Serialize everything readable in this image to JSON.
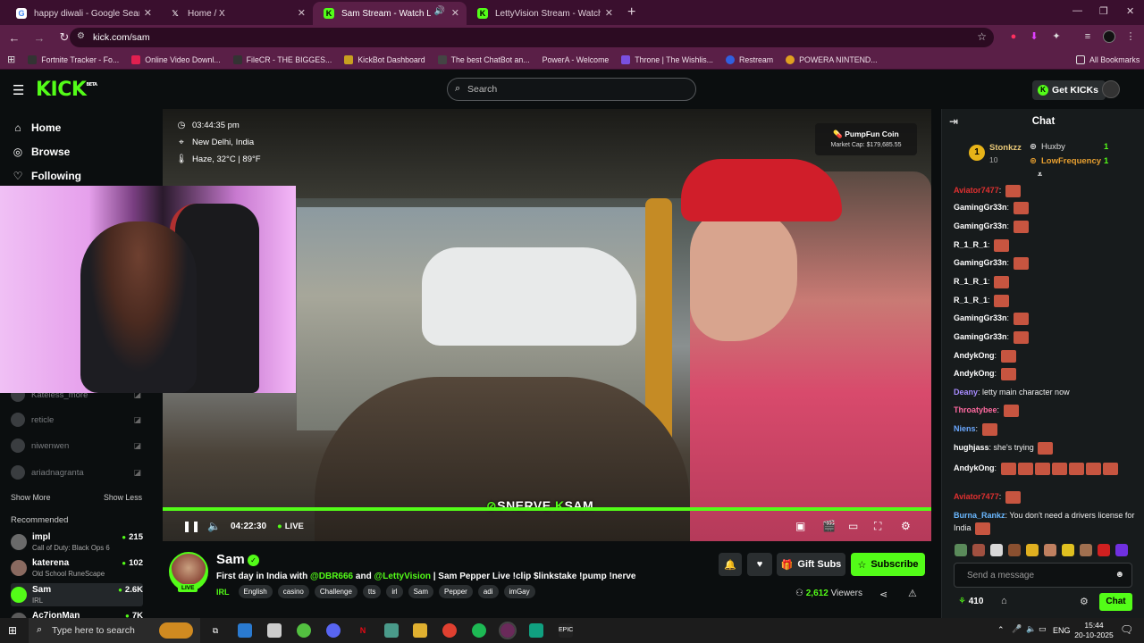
{
  "browser": {
    "tabs": [
      {
        "label": "happy diwali - Google Search",
        "icon": "google-icon",
        "active": false
      },
      {
        "label": "Home / X",
        "icon": "x-icon",
        "active": false
      },
      {
        "label": "Sam Stream - Watch Live o",
        "icon": "kick-icon",
        "active": true
      },
      {
        "label": "LettyVision Stream - Watch Liv",
        "icon": "kick-icon",
        "active": false
      }
    ],
    "new_tab": "+",
    "url": "kick.com/sam",
    "bookmarks": [
      "Fortnite Tracker - Fo...",
      "Online Video Downl...",
      "FileCR - THE BIGGES...",
      "KickBot Dashboard",
      "The best ChatBot an...",
      "PowerA - Welcome",
      "Throne | The Wishlis...",
      "Restream",
      "POWERA NINTEND..."
    ],
    "all_bookmarks": "All Bookmarks"
  },
  "header": {
    "logo": "KICK",
    "logo_badge": "BETA",
    "search_placeholder": "Search",
    "get_kicks": "Get KICKs"
  },
  "sidebar": {
    "nav": [
      {
        "label": "Home",
        "icon": "home-icon"
      },
      {
        "label": "Browse",
        "icon": "compass-icon"
      },
      {
        "label": "Following",
        "icon": "heart-icon"
      }
    ],
    "offline_following": [
      "Kateless_more",
      "reticle",
      "niwenwen",
      "ariadnagranta"
    ],
    "show_more": "Show More",
    "show_less": "Show Less",
    "recommended_title": "Recommended",
    "recommended": [
      {
        "name": "impl",
        "game": "Call of Duty: Black Ops 6",
        "viewers": "215"
      },
      {
        "name": "katerena",
        "game": "Old School RuneScape",
        "viewers": "102"
      },
      {
        "name": "Sam",
        "game": "IRL",
        "viewers": "2.6K"
      },
      {
        "name": "Ac7ionMan",
        "game": "",
        "viewers": "7K"
      }
    ]
  },
  "video": {
    "time": "03:44:35 pm",
    "location": "New Delhi, India",
    "weather": "Haze, 32°C | 89°F",
    "coin_title": "PumpFun Coin",
    "coin_cap": "Market Cap: $179,685.55",
    "watermark_a": "SNERVE",
    "watermark_b": "SAM",
    "timecode": "04:22:30",
    "live": "LIVE"
  },
  "stream": {
    "name": "Sam",
    "avatar_live": "LIVE",
    "title_a": "First day in India with ",
    "mention1": "@DBR666",
    "title_b": " and ",
    "mention2": "@LettyVision",
    "title_c": "  | Sam Pepper Live !clip $linkstake !pump !nerve",
    "category": "IRL",
    "tags": [
      "English",
      "casino",
      "Challenge",
      "tts",
      "irl",
      "Sam",
      "Pepper",
      "adi",
      "imGay"
    ],
    "gift_subs": "Gift Subs",
    "subscribe": "Subscribe",
    "viewers": "2,612",
    "viewers_label": "Viewers"
  },
  "chat": {
    "title": "Chat",
    "leaderboard": [
      {
        "name": "Stonkzz",
        "count": "10",
        "rank": "1"
      },
      {
        "name": "Huxby",
        "count": "1"
      },
      {
        "name": "LowFrequency",
        "count": "1"
      }
    ],
    "messages": [
      {
        "user": "Aviator7477",
        "color": "#e03030",
        "text": "",
        "emotes": 1
      },
      {
        "user": "GamingGr33n",
        "color": "#ffffff",
        "text": "",
        "emotes": 1
      },
      {
        "user": "GamingGr33n",
        "color": "#ffffff",
        "text": "",
        "emotes": 1
      },
      {
        "user": "R_1_R_1",
        "color": "#ffffff",
        "text": "",
        "emotes": 1
      },
      {
        "user": "GamingGr33n",
        "color": "#ffffff",
        "text": "",
        "emotes": 1
      },
      {
        "user": "R_1_R_1",
        "color": "#ffffff",
        "text": "",
        "emotes": 1
      },
      {
        "user": "R_1_R_1",
        "color": "#ffffff",
        "text": "",
        "emotes": 1
      },
      {
        "user": "GamingGr33n",
        "color": "#ffffff",
        "text": "",
        "emotes": 1
      },
      {
        "user": "GamingGr33n",
        "color": "#ffffff",
        "text": "",
        "emotes": 1
      },
      {
        "user": "AndykOng",
        "color": "#ffffff",
        "text": "",
        "emotes": 1
      },
      {
        "user": "AndykOng",
        "color": "#ffffff",
        "text": "",
        "emotes": 1
      },
      {
        "user": "Deany",
        "color": "#a88cff",
        "text": "letty main character now",
        "emotes": 0
      },
      {
        "user": "Throatybee",
        "color": "#ff6aa0",
        "text": "",
        "emotes": 1
      },
      {
        "user": "Niens",
        "color": "#6aa8ff",
        "text": "",
        "emotes": 1
      },
      {
        "user": "hughjass",
        "color": "#ffffff",
        "text": "she's trying",
        "emotes": 1
      },
      {
        "user": "AndykOng",
        "color": "#ffffff",
        "text": "",
        "emotes": 7
      },
      {
        "user": "Aviator7477",
        "color": "#e03030",
        "text": "",
        "emotes": 1
      },
      {
        "user": "Burna_Rankz",
        "color": "#6ab8ff",
        "text": "You don't need a drivers license for India",
        "emotes": 1
      }
    ],
    "send_placeholder": "Send a message",
    "points": "410",
    "chat_button": "Chat"
  },
  "taskbar": {
    "search_placeholder": "Type here to search",
    "lang": "ENG",
    "time": "15:44",
    "date": "20-10-2025"
  }
}
